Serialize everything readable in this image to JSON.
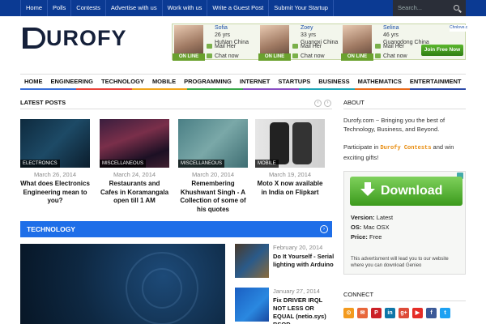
{
  "topnav": {
    "items": [
      "Home",
      "Polls",
      "Contests",
      "Advertise with us",
      "Work with us",
      "Write a Guest Post",
      "Submit Your Startup"
    ],
    "search_placeholder": "Search..."
  },
  "logo": {
    "text": "UROFY"
  },
  "ad_banner": {
    "people": [
      {
        "name": "Sofia",
        "age": "26 yrs",
        "location": "HuNan China",
        "video": "Video",
        "mail": "Mail Her",
        "chat": "Chat now",
        "online": "ON LINE"
      },
      {
        "name": "Zoey",
        "age": "33 yrs",
        "location": "Guangxi China",
        "video": "Video",
        "mail": "Mail Her",
        "chat": "Chat now",
        "online": "ON LINE"
      },
      {
        "name": "Selina",
        "age": "46 yrs",
        "location": "Guangdong China",
        "video": "Video",
        "mail": "Mail Her",
        "chat": "Chat now",
        "online": "ON LINE"
      }
    ],
    "join": "Join Free Now",
    "corner": "Chnlove.c"
  },
  "mainnav": {
    "items": [
      "HOME",
      "ENGINEERING",
      "TECHNOLOGY",
      "MOBILE",
      "PROGRAMMING",
      "INTERNET",
      "STARTUPS",
      "BUSINESS",
      "MATHEMATICS",
      "ENTERTAINMENT"
    ],
    "rainbow": [
      "#3a6fd8",
      "#e8433a",
      "#f0a51c",
      "#3aa84a",
      "#8a4fc4",
      "#1fa6b8",
      "#e86a1a",
      "#2c4aa8"
    ]
  },
  "latest": {
    "title": "LATEST POSTS",
    "posts": [
      {
        "category": "ELECTRONICS",
        "date": "March 26, 2014",
        "title": "What does Electronics Engineering mean to you?"
      },
      {
        "category": "MISCELLANEOUS",
        "date": "March 24, 2014",
        "title": "Restaurants and Cafes in Koramangala open till 1 AM"
      },
      {
        "category": "MISCELLANEOUS",
        "date": "March 20, 2014",
        "title": "Remembering Khushwant Singh - A Collection of some of his quotes"
      },
      {
        "category": "MOBILE",
        "date": "March 19, 2014",
        "title": "Moto X now available in India on Flipkart"
      }
    ]
  },
  "technology": {
    "title": "TECHNOLOGY",
    "side_posts": [
      {
        "date": "February 20, 2014",
        "title": "Do It Yourself - Serial lighting with Arduino"
      },
      {
        "date": "January 27, 2014",
        "title": "Fix DRIVER IRQL NOT LESS OR EQUAL (netio.sys) BSOD"
      }
    ]
  },
  "about": {
    "title": "ABOUT",
    "text": "Durofy.com ~ Bringing you the best of Technology, Business, and Beyond.",
    "participate_pre": "Participate in ",
    "participate_link": "Durofy Contests",
    "participate_post": " and win exciting gifts!"
  },
  "download_ad": {
    "button": "Download",
    "version_label": "Version:",
    "version": "Latest",
    "os_label": "OS:",
    "os": "Mac OSX",
    "price_label": "Price:",
    "price": "Free",
    "note": "This advertisment will lead you to our website where you can download Genieo"
  },
  "connect": {
    "title": "CONNECT",
    "icons": [
      {
        "glyph": "⊙",
        "color": "#f39a1e",
        "name": "rss-icon"
      },
      {
        "glyph": "✉",
        "color": "#e8663a",
        "name": "email-icon"
      },
      {
        "glyph": "P",
        "color": "#cb2027",
        "name": "pinterest-icon"
      },
      {
        "glyph": "in",
        "color": "#0e76a8",
        "name": "linkedin-icon"
      },
      {
        "glyph": "g+",
        "color": "#dd4b39",
        "name": "googleplus-icon"
      },
      {
        "glyph": "▶",
        "color": "#e52d27",
        "name": "youtube-icon"
      },
      {
        "glyph": "f",
        "color": "#3b5998",
        "name": "facebook-icon"
      },
      {
        "glyph": "t",
        "color": "#1da1f2",
        "name": "twitter-icon"
      }
    ]
  }
}
